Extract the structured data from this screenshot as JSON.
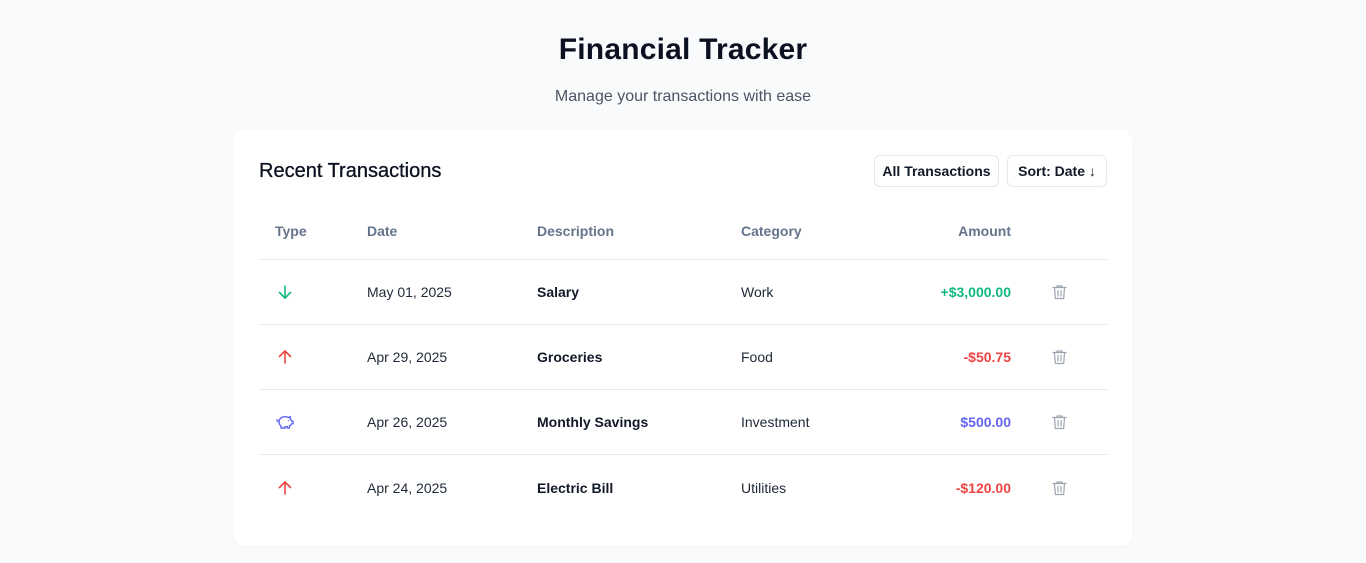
{
  "header": {
    "title": "Financial Tracker",
    "subtitle": "Manage your transactions with ease"
  },
  "card": {
    "title": "Recent Transactions",
    "filter_label": "All Transactions",
    "sort_label": "Sort: Date ↓"
  },
  "table": {
    "columns": {
      "type": "Type",
      "date": "Date",
      "description": "Description",
      "category": "Category",
      "amount": "Amount"
    },
    "rows": [
      {
        "type_icon": "arrow-down-icon",
        "date": "May 01, 2025",
        "description": "Salary",
        "category": "Work",
        "amount": "+$3,000.00",
        "kind": "income"
      },
      {
        "type_icon": "arrow-up-icon",
        "date": "Apr 29, 2025",
        "description": "Groceries",
        "category": "Food",
        "amount": "-$50.75",
        "kind": "expense"
      },
      {
        "type_icon": "piggy-bank-icon",
        "date": "Apr 26, 2025",
        "description": "Monthly Savings",
        "category": "Investment",
        "amount": "$500.00",
        "kind": "savings"
      },
      {
        "type_icon": "arrow-up-icon",
        "date": "Apr 24, 2025",
        "description": "Electric Bill",
        "category": "Utilities",
        "amount": "-$120.00",
        "kind": "expense"
      }
    ],
    "delete_icon": "trash-icon"
  },
  "colors": {
    "income": "#10b981",
    "expense": "#ef4444",
    "savings": "#6366f1",
    "muted": "#9ca3af",
    "background": "#f8fafc"
  }
}
